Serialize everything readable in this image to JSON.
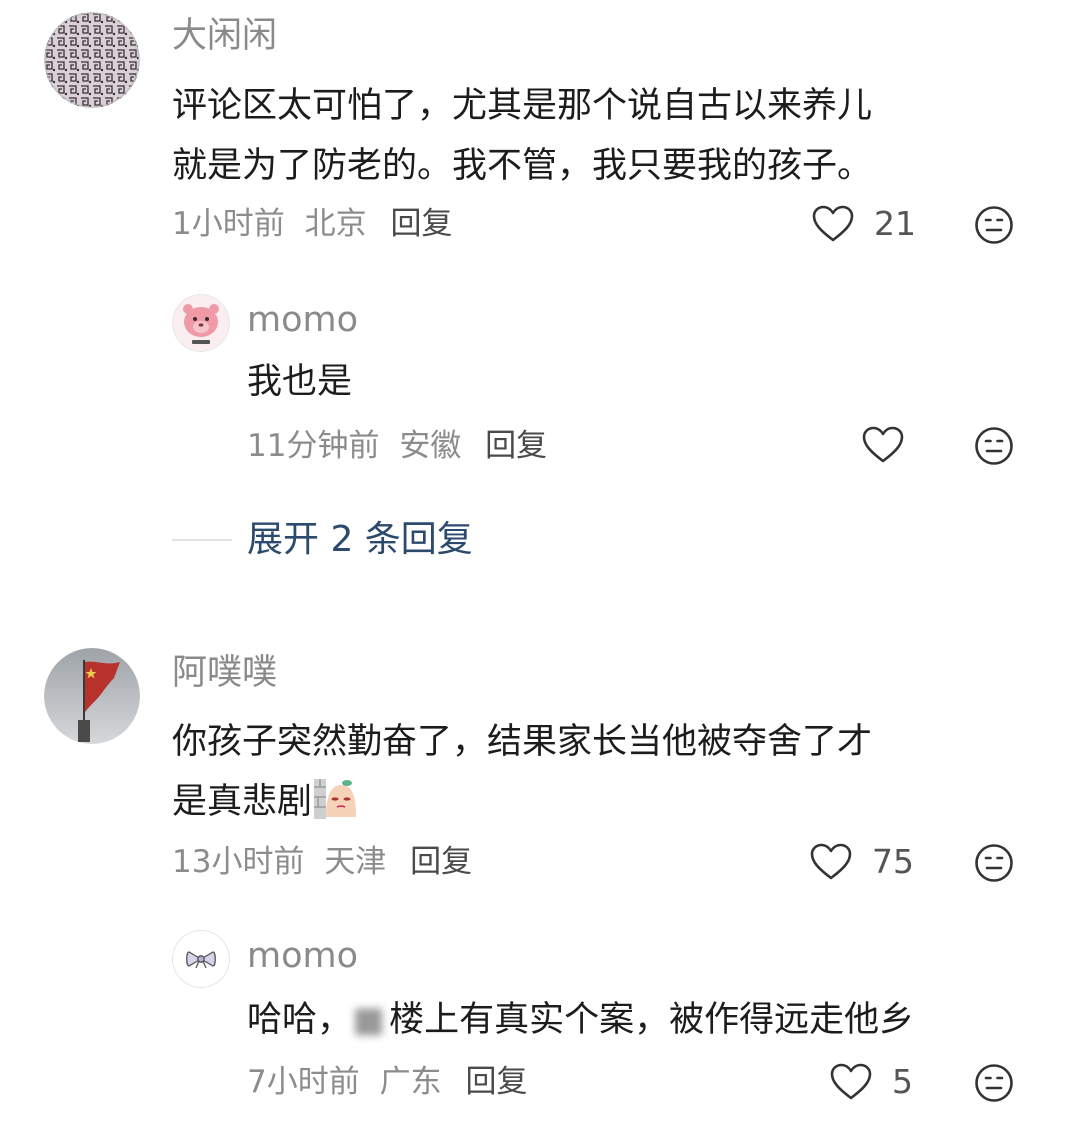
{
  "comments": [
    {
      "username": "大闲闲",
      "text_line1": "评论区太可怕了，尤其是那个说自古以来养儿",
      "text_line2": "就是为了防老的。我不管，我只要我的孩子。",
      "time": "1小时前",
      "location": "北京",
      "reply_label": "回复",
      "likes": "21",
      "replies": [
        {
          "username": "momo",
          "text": "我也是",
          "time": "11分钟前",
          "location": "安徽",
          "reply_label": "回复"
        }
      ],
      "expand_label": "展开 2 条回复"
    },
    {
      "username": "阿噗噗",
      "text_line1": "你孩子突然勤奋了，结果家长当他被夺舍了才",
      "text_line2": "是真悲剧",
      "time": "13小时前",
      "location": "天津",
      "reply_label": "回复",
      "likes": "75",
      "replies": [
        {
          "username": "momo",
          "text_prefix": "哈哈，",
          "text_blurred": "■",
          "text_rest": "楼上有真实个案，被作得远走他乡",
          "time": "7小时前",
          "location": "广东",
          "reply_label": "回复",
          "likes": "5"
        }
      ]
    }
  ],
  "icons": {
    "like": "heart-outline-icon",
    "emoji": "neutral-face-icon"
  },
  "colors": {
    "username": "#8a8a8a",
    "text": "#1c1c1c",
    "meta": "#8c8c8c",
    "expand": "#2b4a6e"
  }
}
